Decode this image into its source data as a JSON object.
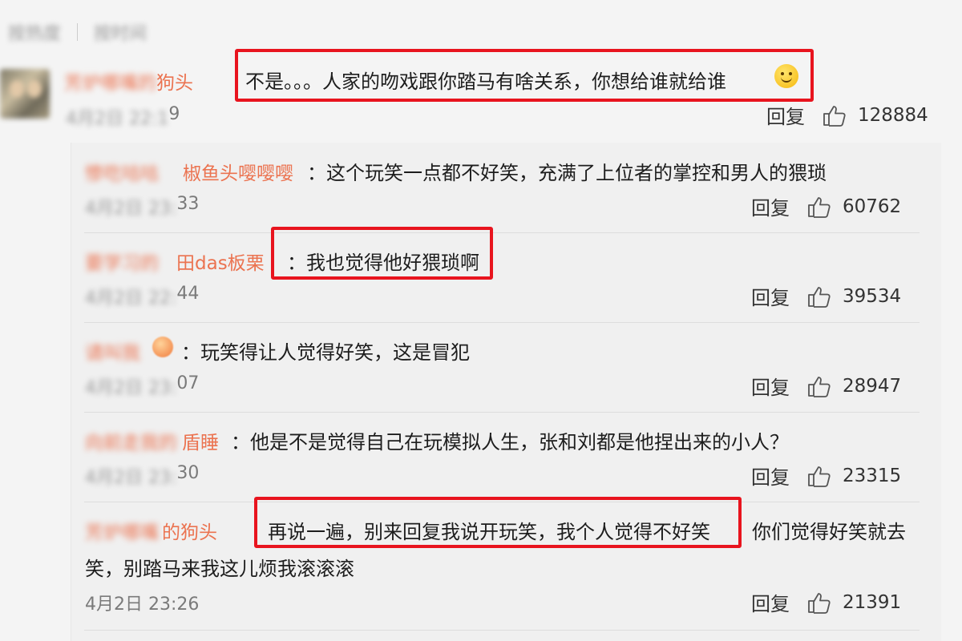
{
  "sort_tabs": [
    "按热度",
    "按时间"
  ],
  "comments": [
    {
      "name_blurred": "芳炉哪嘴的",
      "name_visible": "狗头",
      "text": "不是。。。人家的吻戏跟你踏马有啥关系，你想给谁就给谁",
      "time_blurred": "4月2日 22:1",
      "time_visible": "9",
      "reply_label": "回复",
      "likes": "128884"
    }
  ],
  "replies": [
    {
      "name_blurred": "惨吃咕咕",
      "name_visible": "椒鱼头嘤嘤嘤",
      "text": "：这个玩笑一点都不好笑，充满了上位者的掌控和男人的猥琐",
      "time_blurred": "4月2日 23:",
      "time_visible": "33",
      "reply_label": "回复",
      "likes": "60762"
    },
    {
      "name_blurred": "要学习的",
      "name_visible": "田das板栗",
      "text": "：我也觉得他好猥琐啊",
      "time_blurred": "4月2日 22:",
      "time_visible": "44",
      "reply_label": "回复",
      "likes": "39534"
    },
    {
      "name_blurred": "请叫我",
      "name_visible": "",
      "text": "：玩笑得让人觉得好笑，这是冒犯",
      "time_blurred": "4月2日 23:",
      "time_visible": "07",
      "reply_label": "回复",
      "likes": "28947"
    },
    {
      "name_blurred": "向前走我的",
      "name_visible": "盾睡",
      "text": "：他是不是觉得自己在玩模拟人生，张和刘都是他捏出来的小人？",
      "time_blurred": "4月2日 23:",
      "time_visible": "30",
      "reply_label": "回复",
      "likes": "23315"
    },
    {
      "name_blurred": "芳炉哪嘴",
      "name_visible": "的狗头",
      "text_highlight": "再说一遍，别来回复我说开玩笑，我个人觉得不好笑",
      "text_after": "你们觉得好笑就去",
      "text_line2": "笑，别踏马来我这儿烦我滚滚滚",
      "time": "4月2日 23:26",
      "reply_label": "回复",
      "likes": "21391"
    }
  ],
  "colors": {
    "highlight_box": "#e8141e",
    "username": "#eb7350",
    "background": "#f4f4f4"
  }
}
